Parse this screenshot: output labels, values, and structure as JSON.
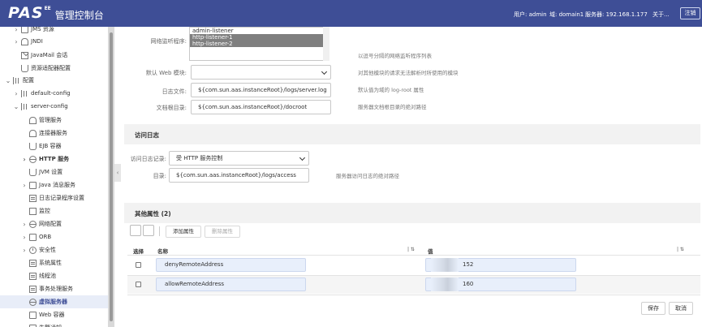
{
  "app": {
    "logo_mark": "PAS",
    "logo_sup": "EE",
    "title": "管理控制台"
  },
  "header": {
    "user": "用户: admin",
    "domain": "域: domain1",
    "server": "服务器: 192.168.1.177",
    "about": "关于...",
    "logout": "注销"
  },
  "sidebar": {
    "items": [
      {
        "label": "JMS 资源",
        "icon": "folder-icon"
      },
      {
        "label": "JNDI",
        "icon": "house-icon"
      },
      {
        "label": "JavaMail 会话",
        "icon": "mail-icon"
      },
      {
        "label": "资源适配器配置",
        "icon": "cup-icon"
      },
      {
        "label": "配置",
        "icon": "bars-icon"
      },
      {
        "label": "default-config",
        "icon": "bars-icon"
      },
      {
        "label": "server-config",
        "icon": "bars-icon"
      },
      {
        "label": "管理服务",
        "icon": "house-icon"
      },
      {
        "label": "连接器服务",
        "icon": "house-icon"
      },
      {
        "label": "EJB 容器",
        "icon": "cup-icon"
      },
      {
        "label": "HTTP 服务",
        "icon": "globe-icon"
      },
      {
        "label": "JVM 设置",
        "icon": "cup-icon"
      },
      {
        "label": "Java 消息服务",
        "icon": "folder-icon"
      },
      {
        "label": "日志记录程序设置",
        "icon": "doc-icon"
      },
      {
        "label": "监控",
        "icon": "check-icon"
      },
      {
        "label": "网络配置",
        "icon": "globe-icon"
      },
      {
        "label": "ORB",
        "icon": "folder-icon"
      },
      {
        "label": "安全性",
        "icon": "clock-icon"
      },
      {
        "label": "系统属性",
        "icon": "doc-icon"
      },
      {
        "label": "线程池",
        "icon": "doc-icon"
      },
      {
        "label": "事务处理服务",
        "icon": "doc-icon"
      },
      {
        "label": "虚拟服务器",
        "icon": "globe-icon"
      },
      {
        "label": "Web 容器",
        "icon": "folder-icon"
      },
      {
        "label": "告警通知",
        "icon": "folder-icon"
      }
    ],
    "selected": "虚拟服务器"
  },
  "form": {
    "listeners_label": "网络监听程序:",
    "listeners_options": [
      "admin-listener",
      "http-listener-1",
      "http-listener-2"
    ],
    "listeners_hint": "以逗号分隔的网络监听程序列表",
    "web_module_label": "默认 Web 模块:",
    "web_module_value": "",
    "web_module_hint": "对其他模块的请求无法解析时所使用的模块",
    "log_file_label": "日志文件:",
    "log_file_value": "${com.sun.aas.instanceRoot}/logs/server.log",
    "log_file_hint": "默认值为域的 log-root 属性",
    "docroot_label": "文档根目录:",
    "docroot_value": "${com.sun.aas.instanceRoot}/docroot",
    "docroot_hint": "服务器文档根目录的绝对路径"
  },
  "access_log": {
    "section_title": "访问日志",
    "record_label": "访问日志记录:",
    "record_value": "受 HTTP 服务控制",
    "dir_label": "目录:",
    "dir_value": "${com.sun.aas.instanceRoot}/logs/access",
    "dir_hint": "服务器访问日志的绝对路径"
  },
  "properties": {
    "section_title": "其他属性 (2)",
    "add_button": "添加属性",
    "delete_button": "删除属性",
    "columns": {
      "select": "选择",
      "name": "名称",
      "value": "值"
    },
    "rows": [
      {
        "name": "denyRemoteAddress",
        "value": "152"
      },
      {
        "name": "allowRemoteAddress",
        "value": "160"
      }
    ]
  },
  "actions": {
    "save": "保存",
    "cancel": "取消"
  }
}
